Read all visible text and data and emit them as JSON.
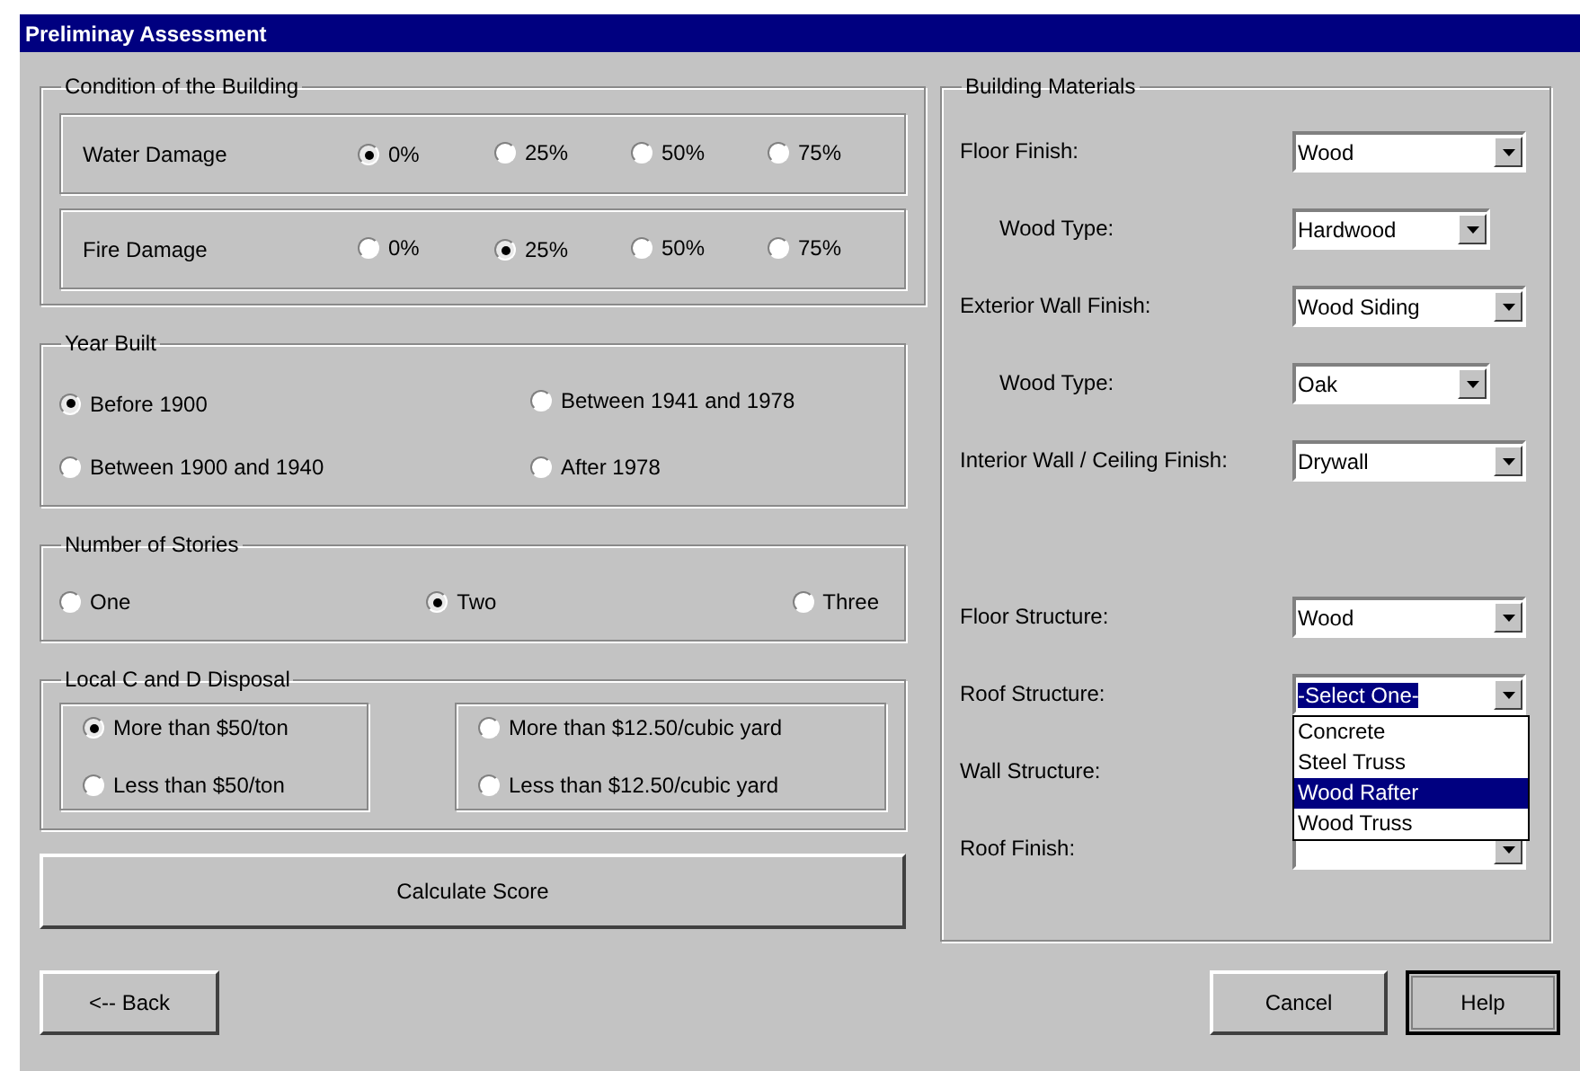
{
  "window": {
    "title": "Preliminay Assessment"
  },
  "condition": {
    "title": "Condition of the Building",
    "rows": [
      {
        "label": "Water Damage",
        "options": [
          {
            "label": "0%",
            "selected": true
          },
          {
            "label": "25%",
            "selected": false
          },
          {
            "label": "50%",
            "selected": false
          },
          {
            "label": "75%",
            "selected": false
          }
        ]
      },
      {
        "label": "Fire Damage",
        "options": [
          {
            "label": "0%",
            "selected": false
          },
          {
            "label": "25%",
            "selected": true
          },
          {
            "label": "50%",
            "selected": false
          },
          {
            "label": "75%",
            "selected": false
          }
        ]
      }
    ]
  },
  "year_built": {
    "title": "Year Built",
    "options": [
      {
        "label": "Before 1900",
        "selected": true
      },
      {
        "label": "Between 1941 and 1978",
        "selected": false
      },
      {
        "label": "Between 1900 and 1940",
        "selected": false
      },
      {
        "label": "After 1978",
        "selected": false
      }
    ]
  },
  "stories": {
    "title": "Number of Stories",
    "options": [
      {
        "label": "One",
        "selected": false
      },
      {
        "label": "Two",
        "selected": true
      },
      {
        "label": "Three",
        "selected": false
      }
    ]
  },
  "disposal": {
    "title": "Local C and D Disposal",
    "groups": [
      [
        {
          "label": "More than $50/ton",
          "selected": true
        },
        {
          "label": "Less than $50/ton",
          "selected": false
        }
      ],
      [
        {
          "label": "More than $12.50/cubic yard",
          "selected": false
        },
        {
          "label": "Less than $12.50/cubic yard",
          "selected": false
        }
      ]
    ]
  },
  "calculate_button": "Calculate Score",
  "materials": {
    "title": "Building Materials",
    "fields": [
      {
        "kind": "field",
        "label": "Floor Finish:",
        "value": "Wood"
      },
      {
        "kind": "subfield",
        "label": "Wood Type:",
        "value": "Hardwood"
      },
      {
        "kind": "field",
        "label": "Exterior Wall Finish:",
        "value": "Wood Siding"
      },
      {
        "kind": "subfield",
        "label": "Wood Type:",
        "value": "Oak"
      },
      {
        "kind": "field",
        "label": "Interior Wall / Ceiling Finish:",
        "value": "Drywall"
      },
      {
        "kind": "spacer"
      },
      {
        "kind": "field",
        "label": "Floor Structure:",
        "value": "Wood"
      },
      {
        "kind": "field",
        "label": "Roof Structure:",
        "value": "-Select One-",
        "focused": true,
        "open": true
      },
      {
        "kind": "covered",
        "label": "Wall Structure:"
      },
      {
        "kind": "field",
        "label": "Roof Finish:"
      }
    ]
  },
  "dropdown_list": {
    "items": [
      {
        "label": "Concrete",
        "selected": false
      },
      {
        "label": "Steel Truss",
        "selected": false
      },
      {
        "label": "Wood Rafter",
        "selected": true
      },
      {
        "label": "Wood Truss",
        "selected": false
      }
    ]
  },
  "buttons": {
    "back": "<-- Back",
    "cancel": "Cancel",
    "help": "Help"
  }
}
